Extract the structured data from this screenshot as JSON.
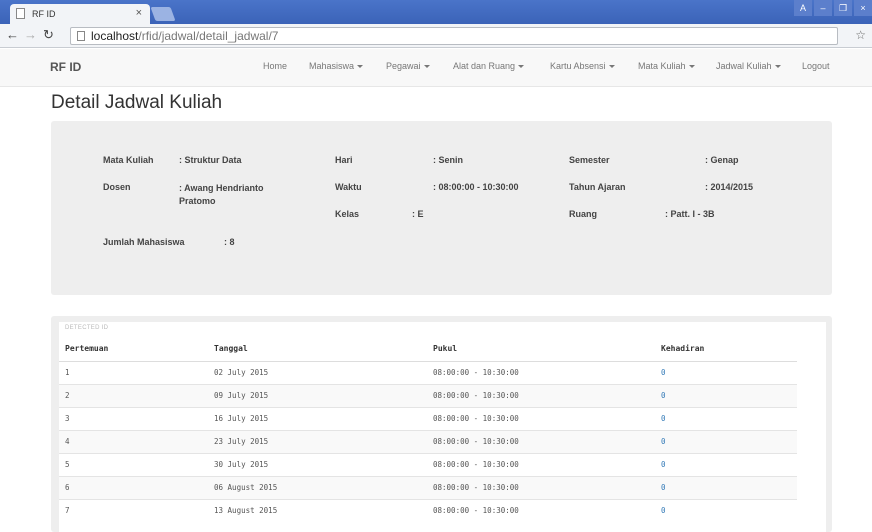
{
  "browser": {
    "tab_title": "RF ID",
    "tab_close": "×",
    "url_host": "localhost",
    "url_path": "/rfid/jadwal/detail_jadwal/7",
    "window_buttons": [
      "A",
      "–",
      "❐",
      "×"
    ]
  },
  "navbar": {
    "brand": "RF ID",
    "items": [
      {
        "label": "Home",
        "dropdown": false
      },
      {
        "label": "Mahasiswa",
        "dropdown": true
      },
      {
        "label": "Pegawai",
        "dropdown": true
      },
      {
        "label": "Alat dan Ruang",
        "dropdown": true
      },
      {
        "label": "Kartu Absensi",
        "dropdown": true
      },
      {
        "label": "Mata Kuliah",
        "dropdown": true
      },
      {
        "label": "Jadwal Kuliah",
        "dropdown": true
      },
      {
        "label": "Logout",
        "dropdown": false
      }
    ]
  },
  "page": {
    "title": "Detail Jadwal Kuliah"
  },
  "detail": {
    "mata_kuliah_label": "Mata Kuliah",
    "mata_kuliah_value": ": Struktur Data",
    "dosen_label": "Dosen",
    "dosen_value": ": Awang Hendrianto Pratomo",
    "jumlah_label": "Jumlah Mahasiswa",
    "jumlah_value": ": 8",
    "hari_label": "Hari",
    "hari_value": ": Senin",
    "waktu_label": "Waktu",
    "waktu_value": ": 08:00:00 - 10:30:00",
    "kelas_label": "Kelas",
    "kelas_value": ": E",
    "semester_label": "Semester",
    "semester_value": ": Genap",
    "tahun_label": "Tahun Ajaran",
    "tahun_value": ": 2014/2015",
    "ruang_label": "Ruang",
    "ruang_value": ": Patt. I - 3B"
  },
  "table": {
    "caption": "DETECTED ID",
    "headers": [
      "Pertemuan",
      "Tanggal",
      "Pukul",
      "Kehadiran"
    ],
    "rows": [
      [
        "1",
        "02 July 2015",
        "08:00:00 - 10:30:00",
        "0"
      ],
      [
        "2",
        "09 July 2015",
        "08:00:00 - 10:30:00",
        "0"
      ],
      [
        "3",
        "16 July 2015",
        "08:00:00 - 10:30:00",
        "0"
      ],
      [
        "4",
        "23 July 2015",
        "08:00:00 - 10:30:00",
        "0"
      ],
      [
        "5",
        "30 July 2015",
        "08:00:00 - 10:30:00",
        "0"
      ],
      [
        "6",
        "06 August 2015",
        "08:00:00 - 10:30:00",
        "0"
      ],
      [
        "7",
        "13 August 2015",
        "08:00:00 - 10:30:00",
        "0"
      ]
    ]
  }
}
